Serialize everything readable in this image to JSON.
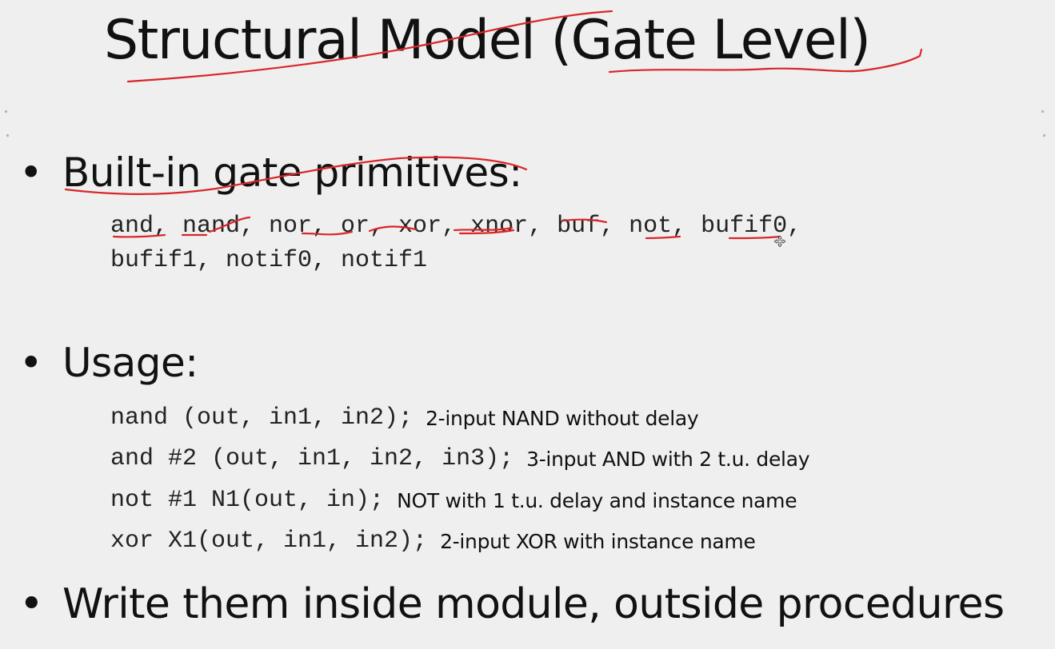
{
  "title": "Structural Model (Gate Level)",
  "bullet_glyph": "•",
  "bullets": [
    {
      "label": "Built-in gate primitives:",
      "lines": [
        "and, nand, nor, or, xor, xnor, buf, not, bufif0,",
        "bufif1, notif0, notif1"
      ]
    },
    {
      "label": "Usage:",
      "rows": [
        {
          "code": "nand (out, in1, in2);",
          "desc": "2-input NAND without delay"
        },
        {
          "code": "and #2 (out, in1, in2, in3);",
          "desc": "3-input AND with 2 t.u. delay"
        },
        {
          "code": "not #1 N1(out, in);",
          "desc": "NOT with 1 t.u. delay and instance name"
        },
        {
          "code": "xor X1(out, in1, in2);",
          "desc": "2-input XOR with instance name"
        }
      ]
    },
    {
      "label": "Write them inside module, outside procedures"
    }
  ],
  "colors": {
    "background": "#efefef",
    "text": "#111111",
    "annotation_ink": "#d8262a"
  }
}
